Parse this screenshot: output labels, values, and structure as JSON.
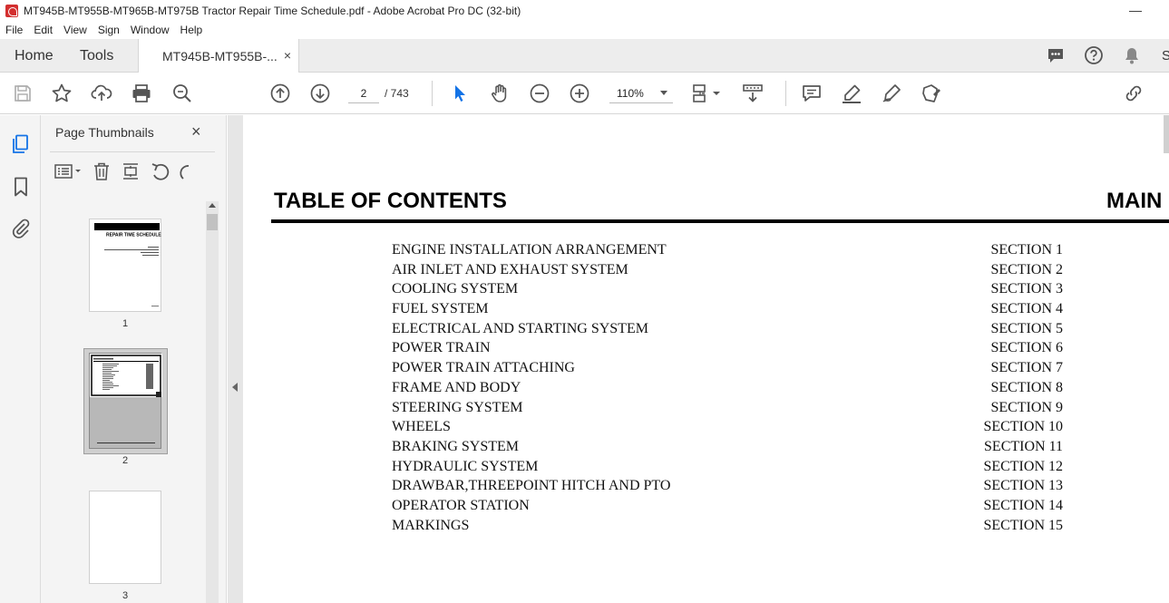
{
  "window": {
    "title": "MT945B-MT955B-MT965B-MT975B Tractor Repair Time Schedule.pdf - Adobe Acrobat Pro DC (32-bit)",
    "minimize": "—"
  },
  "menu": [
    "File",
    "Edit",
    "View",
    "Sign",
    "Window",
    "Help"
  ],
  "tabs": {
    "home": "Home",
    "tools": "Tools",
    "doc_tab": "MT945B-MT955B-...",
    "close": "×"
  },
  "toolbar": {
    "page_current": "2",
    "page_total": "/ 743",
    "zoom": "110%"
  },
  "thumb_panel": {
    "title": "Page Thumbnails",
    "close": "×",
    "pages": [
      "1",
      "2",
      "3"
    ],
    "selected_page": "2"
  },
  "document": {
    "heading": "TABLE OF CONTENTS",
    "heading_right": "MAIN",
    "toc": [
      {
        "name": "ENGINE INSTALLATION ARRANGEMENT",
        "section": "SECTION 1"
      },
      {
        "name": "AIR INLET AND EXHAUST SYSTEM",
        "section": "SECTION 2"
      },
      {
        "name": "COOLING SYSTEM",
        "section": "SECTION 3"
      },
      {
        "name": "FUEL SYSTEM",
        "section": "SECTION 4"
      },
      {
        "name": "ELECTRICAL AND STARTING SYSTEM",
        "section": "SECTION 5"
      },
      {
        "name": "POWER TRAIN",
        "section": "SECTION 6"
      },
      {
        "name": "POWER TRAIN ATTACHING",
        "section": "SECTION 7"
      },
      {
        "name": "FRAME AND BODY",
        "section": "SECTION 8"
      },
      {
        "name": "STEERING SYSTEM",
        "section": "SECTION 9"
      },
      {
        "name": "WHEELS",
        "section": "SECTION 10"
      },
      {
        "name": "BRAKING SYSTEM",
        "section": "SECTION 11"
      },
      {
        "name": "HYDRAULIC SYSTEM",
        "section": "SECTION 12"
      },
      {
        "name": "DRAWBAR,THREEPOINT HITCH AND PTO",
        "section": "SECTION 13"
      },
      {
        "name": "OPERATOR STATION",
        "section": "SECTION 14"
      },
      {
        "name": "MARKINGS",
        "section": "SECTION 15"
      }
    ]
  },
  "thumb1": {
    "heading": "REPAIR TIME SCHEDULE"
  },
  "colors": {
    "accent_blue": "#1473e6",
    "acrobat_red": "#d32f2f",
    "icon_gray": "#555555"
  },
  "icons": [
    "save-icon",
    "bookmark-star-icon",
    "upload-icon",
    "print-icon",
    "search-icon",
    "prev-page-icon",
    "next-page-icon",
    "select-cursor-icon",
    "hand-icon",
    "zoom-out-icon",
    "zoom-in-icon",
    "page-layout-icon",
    "scroll-mode-icon",
    "comment-icon",
    "highlight-icon",
    "draw-icon",
    "stamp-icon",
    "share-link-icon",
    "help-icon",
    "bell-icon",
    "chat-icon"
  ]
}
